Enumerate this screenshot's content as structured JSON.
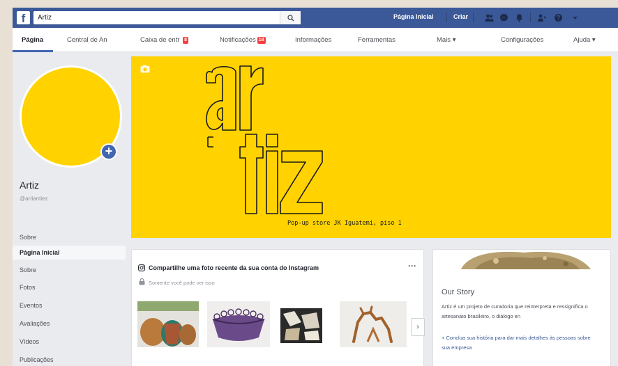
{
  "topbar": {
    "logo": "f",
    "search_value": "Artiz",
    "nav": [
      "Página Inicial",
      "Criar"
    ],
    "icons": [
      "people-icon",
      "messenger-icon",
      "notifications-icon",
      "friend-requests-icon",
      "help-icon",
      "dropdown-icon"
    ]
  },
  "tabs": [
    {
      "label": "Página"
    },
    {
      "label": "Central de An"
    },
    {
      "label": "Caixa de entr"
    },
    {
      "label": "Notificações"
    },
    {
      "label": "Informações"
    },
    {
      "label": "Ferramentas"
    },
    {
      "label": "Mais ▾"
    },
    {
      "label": "Configurações"
    },
    {
      "label": "Ajuda ▾"
    }
  ],
  "inbox_badge": "8",
  "notif_badge": "18",
  "page": {
    "name": "Artiz",
    "handle": "@artiantiez"
  },
  "sidebar": {
    "items": [
      "Sobre",
      "Página Inicial",
      "Sobre",
      "Fotos",
      "Eventos",
      "Avaliações",
      "Vídeos",
      "Publicações"
    ]
  },
  "cover": {
    "caption": "Pop-up store JK Iguatemi, piso 1",
    "logo_letters": [
      "a",
      "r",
      "t",
      "i",
      "z"
    ]
  },
  "instagram_card": {
    "title": "Compartilhe uma foto recente da sua conta do Instagram",
    "subtitle": "Somente você pode ver isso",
    "more": "···",
    "next": "›"
  },
  "story": {
    "title": "Our Story",
    "text": "Artiz é um projeto de curadoria que reinterpreta e ressignifica o artesanato brasileiro, o diálogo en",
    "link": "+ Conclua sua história para dar mais detalhes às pessoas sobre sua empresa"
  },
  "colors": {
    "facebook_blue": "#3b5998",
    "brand_yellow": "#ffd200",
    "badge_red": "#fa3e3e"
  }
}
